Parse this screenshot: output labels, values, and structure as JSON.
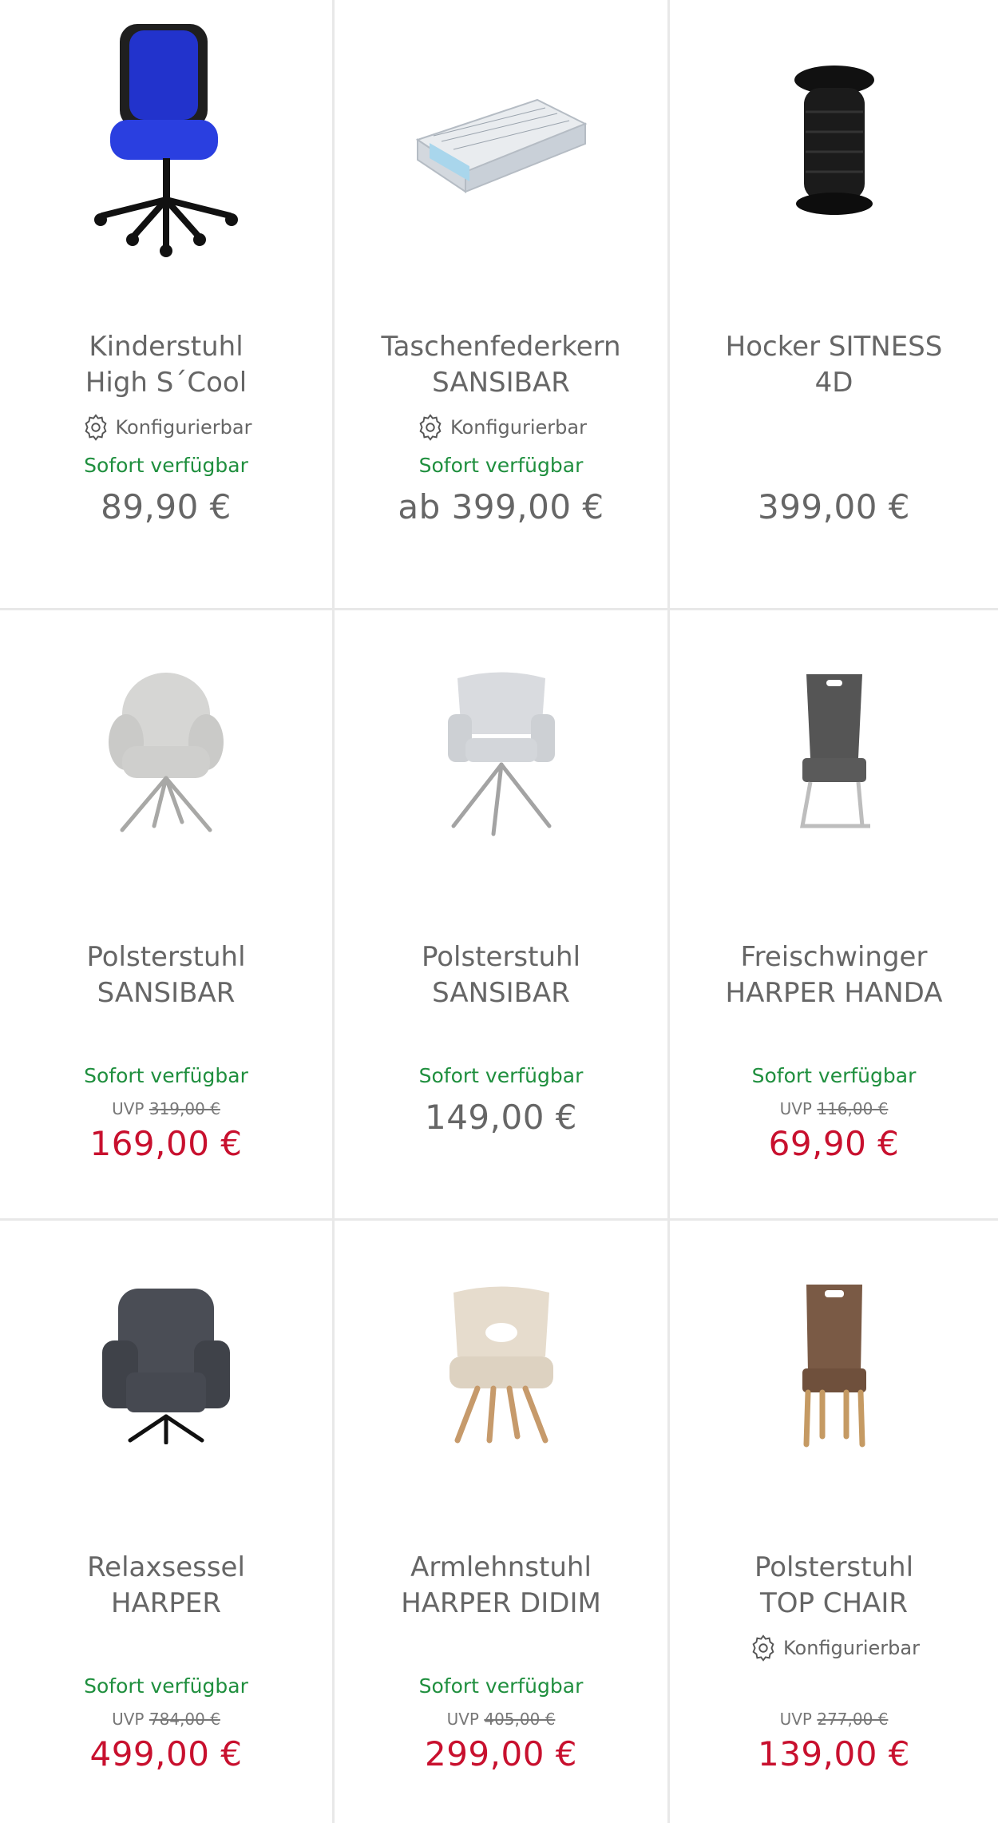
{
  "colors": {
    "available": "#1f8f3e",
    "sale_price": "#c8102e",
    "text": "#666666",
    "divider": "#e8e8e8"
  },
  "products": [
    {
      "name_line1": "Kinderstuhl",
      "name_line2": "High S´Cool",
      "configurable": "Konfigurierbar",
      "availability": "Sofort verfügbar",
      "uvp_label": "",
      "uvp_value": "",
      "price": "89,90 €",
      "sale": false,
      "image": "blue-office-chair"
    },
    {
      "name_line1": "Taschenfederkern",
      "name_line2": "SANSIBAR",
      "configurable": "Konfigurierbar",
      "availability": "Sofort verfügbar",
      "uvp_label": "",
      "uvp_value": "",
      "price": "ab 399,00 €",
      "sale": false,
      "image": "mattress"
    },
    {
      "name_line1": "Hocker SITNESS",
      "name_line2": "4D",
      "configurable": "",
      "availability": "",
      "uvp_label": "",
      "uvp_value": "",
      "price": "399,00 €",
      "sale": false,
      "image": "black-stool"
    },
    {
      "name_line1": "Polsterstuhl",
      "name_line2": "SANSIBAR",
      "configurable": "",
      "availability": "Sofort verfügbar",
      "uvp_label": "UVP",
      "uvp_value": "319,00 €",
      "price": "169,00 €",
      "sale": true,
      "image": "round-grey-chair"
    },
    {
      "name_line1": "Polsterstuhl",
      "name_line2": "SANSIBAR",
      "configurable": "",
      "availability": "Sofort verfügbar",
      "uvp_label": "",
      "uvp_value": "",
      "price": "149,00 €",
      "sale": false,
      "image": "light-grey-armchair"
    },
    {
      "name_line1": "Freischwinger",
      "name_line2": "HARPER HANDA",
      "configurable": "",
      "availability": "Sofort verfügbar",
      "uvp_label": "UVP",
      "uvp_value": "116,00 €",
      "price": "69,90 €",
      "sale": true,
      "image": "cantilever-chair"
    },
    {
      "name_line1": "Relaxsessel",
      "name_line2": "HARPER",
      "configurable": "",
      "availability": "Sofort verfügbar",
      "uvp_label": "UVP",
      "uvp_value": "784,00 €",
      "price": "499,00 €",
      "sale": true,
      "image": "recliner"
    },
    {
      "name_line1": "Armlehnstuhl",
      "name_line2": "HARPER DIDIM",
      "configurable": "",
      "availability": "Sofort verfügbar",
      "uvp_label": "UVP",
      "uvp_value": "405,00 €",
      "price": "299,00 €",
      "sale": true,
      "image": "beige-armchair"
    },
    {
      "name_line1": "Polsterstuhl",
      "name_line2": "TOP CHAIR",
      "configurable": "Konfigurierbar",
      "availability": "",
      "uvp_label": "UVP",
      "uvp_value": "277,00 €",
      "price": "139,00 €",
      "sale": true,
      "image": "brown-dining-chair"
    }
  ]
}
